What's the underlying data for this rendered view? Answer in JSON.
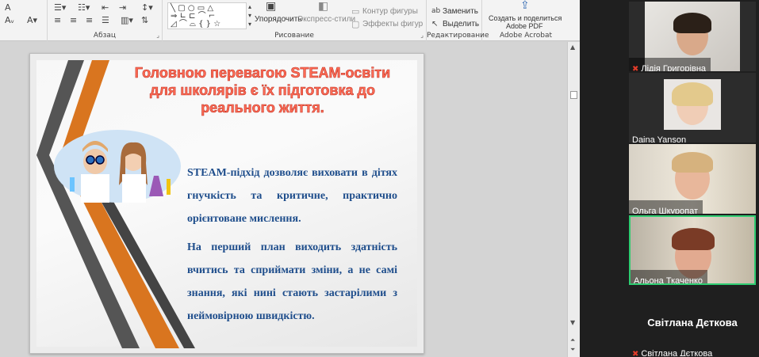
{
  "ribbon": {
    "groups": {
      "paragraph": "Абзац",
      "drawing": "Рисование",
      "editing": "Редактирование",
      "acrobat": "Adobe Acrobat"
    },
    "buttons": {
      "arrange": "Упорядочить",
      "quick_styles": "Экспресс-стили",
      "shape_outline": "Контур фигуры",
      "shape_effects": "Эффекты фигур",
      "replace": "Заменить",
      "select": "Выделить",
      "share_pdf_line1": "Создать и поделиться",
      "share_pdf_line2": "Adobe PDF"
    }
  },
  "slide": {
    "title": "Головною перевагою STEAM-освіти для школярів є їх підготовка до реального життя.",
    "paragraph1": "STEAM-підхід дозволяє виховати в дітях гнучкість та критичне, практично орієнтоване мислення.",
    "paragraph2": "На перший план виходить здатність вчитись та сприймати зміни, а не самі знання, які нині стають застарілими з неймовірною швидкістю."
  },
  "participants": [
    {
      "name": "Лідія Григорівна",
      "muted": true
    },
    {
      "name": "Daina Yanson",
      "muted": false
    },
    {
      "name": "Ольга Шкуропат",
      "muted": false
    },
    {
      "name": "Альона Ткаченко",
      "muted": false,
      "active_speaker": true
    },
    {
      "name": "Світлана Дєткова",
      "muted": true,
      "camera_off": true,
      "display_name": "Світлана Дєткова"
    }
  ],
  "colors": {
    "title_red": "#ff6b55",
    "body_blue": "#1f4e8c",
    "stripe_orange": "#d9751f",
    "stripe_dark": "#555555",
    "active_border": "#2ecc71",
    "mute_red": "#e23c2a"
  }
}
